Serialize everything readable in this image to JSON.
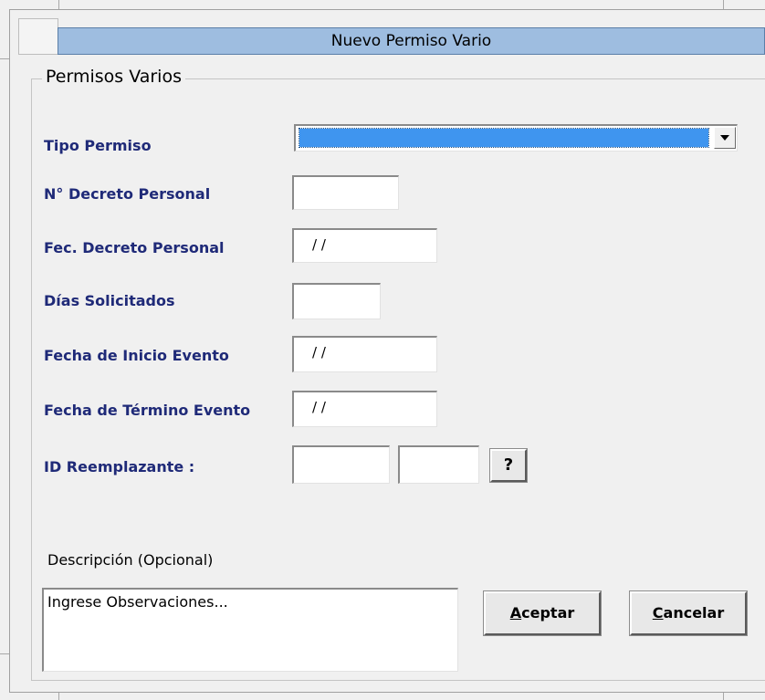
{
  "window": {
    "title": "Nuevo Permiso Vario"
  },
  "group": {
    "legend": "Permisos Varios"
  },
  "fields": {
    "tipo_permiso": {
      "label": "Tipo Permiso",
      "value": ""
    },
    "nro_decreto": {
      "label": "N° Decreto Personal",
      "value": ""
    },
    "fec_decreto": {
      "label": "Fec. Decreto Personal",
      "value": " / /"
    },
    "dias_solicitados": {
      "label": "Días Solicitados",
      "value": ""
    },
    "fecha_inicio": {
      "label": "Fecha de Inicio Evento",
      "value": " / /"
    },
    "fecha_termino": {
      "label": "Fecha de Término Evento",
      "value": " / /"
    },
    "id_reemplazante": {
      "label": "ID Reemplazante :",
      "value1": "",
      "value2": "",
      "lookup_label": "?"
    }
  },
  "descripcion": {
    "label": "Descripción (Opcional)",
    "value": "Ingrese Observaciones..."
  },
  "buttons": {
    "aceptar": {
      "hotkey": "A",
      "rest": "ceptar"
    },
    "cancelar": {
      "hotkey": "C",
      "rest": "ancelar"
    }
  },
  "colors": {
    "titlebar": "#9ebde0",
    "label_text": "#1f2a78",
    "selection": "#3f95ef"
  },
  "icons": {
    "combo_arrow": "chevron-down-icon"
  }
}
